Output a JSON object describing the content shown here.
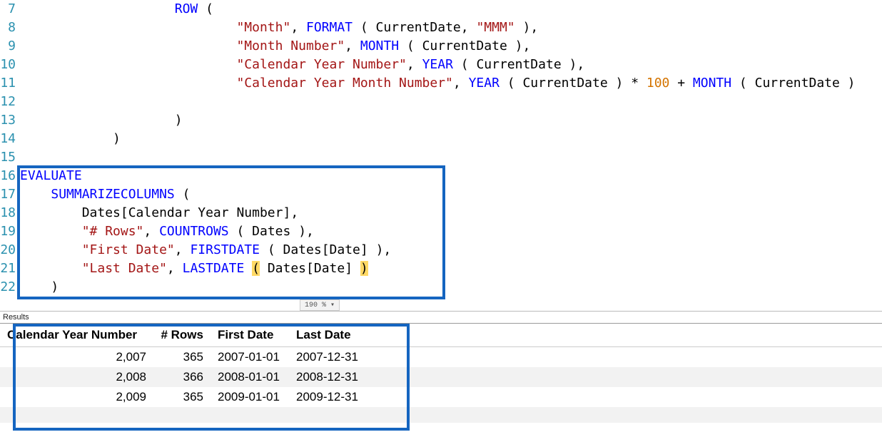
{
  "chart_data": {
    "type": "table",
    "columns": [
      "Calendar Year Number",
      "# Rows",
      "First Date",
      "Last Date"
    ],
    "rows": [
      [
        2007,
        365,
        "2007-01-01",
        "2007-12-31"
      ],
      [
        2008,
        366,
        "2008-01-01",
        "2008-12-31"
      ],
      [
        2009,
        365,
        "2009-01-01",
        "2009-12-31"
      ]
    ]
  },
  "editor": {
    "lines": {
      "l7": "7",
      "l8": "8",
      "l9": "9",
      "l10": "10",
      "l11": "11",
      "l12": "12",
      "l13": "13",
      "l14": "14",
      "l15": "15",
      "l16": "16",
      "l17": "17",
      "l18": "18",
      "l19": "19",
      "l20": "20",
      "l21": "21",
      "l22": "22"
    },
    "code": {
      "row": "ROW",
      "open_paren": " (",
      "close_paren": ")",
      "comma": ",",
      "month_lbl": "\"Month\"",
      "format_fn": "FORMAT",
      "currentdate": " CurrentDate",
      "mmm": "\"MMM\"",
      "month_number_lbl": "\"Month Number\"",
      "month_fn": "MONTH",
      "cal_year_num_lbl": "\"Calendar Year Number\"",
      "year_fn": "YEAR",
      "cal_year_month_num_lbl": "\"Calendar Year Month Number\"",
      "mult": " * ",
      "n100": "100",
      "plus": " + ",
      "evaluate": "EVALUATE",
      "summarizecolumns": "SUMMARIZECOLUMNS",
      "dates_cal_year": "Dates[Calendar Year Number]",
      "rows_lbl": "\"# Rows\"",
      "countrows": "COUNTROWS",
      "dates": " Dates ",
      "firstdate_lbl": "\"First Date\"",
      "firstdate_fn": "FIRSTDATE",
      "dates_date": " Dates[Date] ",
      "lastdate_lbl": "\"Last Date\"",
      "lastdate_fn": "LASTDATE",
      "open_hl": "(",
      "close_hl": ")"
    },
    "zoom": "190 %  ▾",
    "indent1": "            ",
    "indent2": "                    ",
    "indent3": "        ",
    "indent4": "    ",
    "indent5": "        ",
    "indent_close1": "                ",
    "sp": " "
  },
  "results": {
    "label": "Results",
    "headers": {
      "c1": "Calendar Year Number",
      "c2": "# Rows",
      "c3": "First Date",
      "c4": "Last Date"
    },
    "rows": [
      {
        "year": "2,007",
        "count": "365",
        "first": "2007-01-01",
        "last": "2007-12-31"
      },
      {
        "year": "2,008",
        "count": "366",
        "first": "2008-01-01",
        "last": "2008-12-31"
      },
      {
        "year": "2,009",
        "count": "365",
        "first": "2009-01-01",
        "last": "2009-12-31"
      }
    ]
  }
}
